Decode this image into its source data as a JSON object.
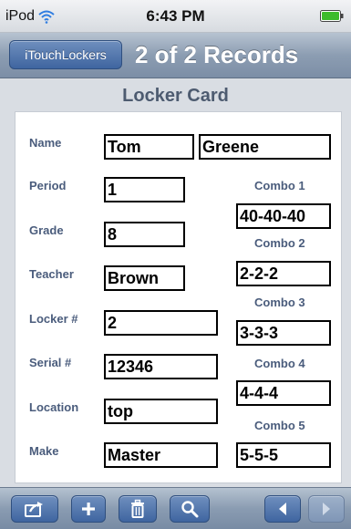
{
  "status_bar": {
    "carrier": "iPod",
    "time": "6:43 PM",
    "wifi_icon": "wifi-icon",
    "battery_icon": "battery-icon"
  },
  "nav_bar": {
    "back_button_label": "iTouchLockers",
    "title": "2 of 2 Records"
  },
  "card": {
    "title": "Locker Card",
    "labels": {
      "name": "Name",
      "period": "Period",
      "grade": "Grade",
      "teacher": "Teacher",
      "locker": "Locker #",
      "serial": "Serial #",
      "location": "Location",
      "make": "Make",
      "combo1": "Combo 1",
      "combo2": "Combo 2",
      "combo3": "Combo 3",
      "combo4": "Combo 4",
      "combo5": "Combo 5"
    },
    "values": {
      "first_name": "Tom",
      "last_name": "Greene",
      "period": "1",
      "grade": "8",
      "teacher": "Brown",
      "locker": "2",
      "serial": "12346",
      "location": "top",
      "make": "Master",
      "combo1": "40-40-40",
      "combo2": "2-2-2",
      "combo3": "3-3-3",
      "combo4": "4-4-4",
      "combo5": "5-5-5"
    }
  },
  "toolbar": {
    "buttons": [
      {
        "name": "share",
        "icon": "share-icon",
        "enabled": true
      },
      {
        "name": "add",
        "icon": "plus-icon",
        "enabled": true
      },
      {
        "name": "delete",
        "icon": "trash-icon",
        "enabled": true
      },
      {
        "name": "search",
        "icon": "search-icon",
        "enabled": true
      },
      {
        "name": "previous",
        "icon": "arrow-left-icon",
        "enabled": true
      },
      {
        "name": "next",
        "icon": "arrow-right-icon",
        "enabled": false
      }
    ]
  },
  "colors": {
    "label_text": "#4a5c7c",
    "bar_blue": "#3f65a0",
    "battery_green": "#3dbb2c"
  }
}
